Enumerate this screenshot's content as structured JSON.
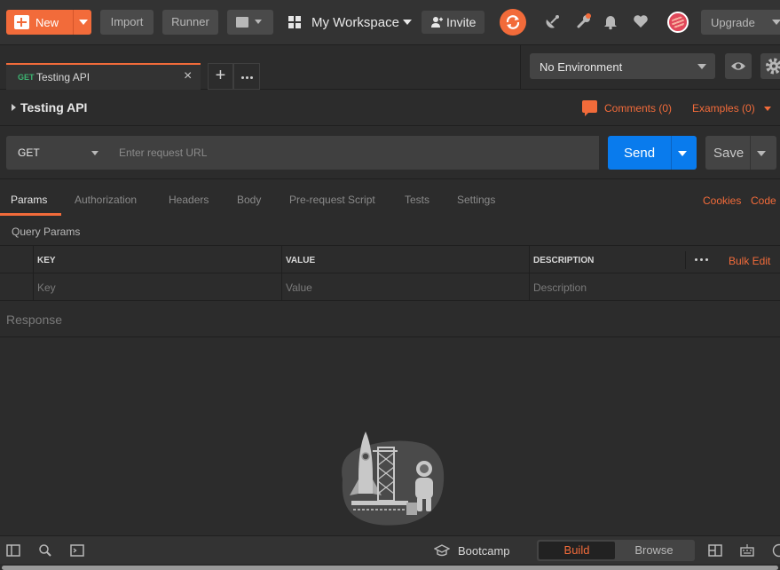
{
  "header": {
    "new_label": "New",
    "import_label": "Import",
    "runner_label": "Runner",
    "workspace_label": "My Workspace",
    "invite_label": "Invite",
    "upgrade_label": "Upgrade",
    "accent_color": "#f26b3a"
  },
  "tabs": [
    {
      "method": "GET",
      "name": "Testing API"
    }
  ],
  "environment": {
    "selected": "No Environment"
  },
  "request": {
    "title": "Testing API",
    "comments_label": "Comments (0)",
    "examples_label": "Examples (0)",
    "method": "GET",
    "url_placeholder": "Enter request URL",
    "send_label": "Send",
    "save_label": "Save",
    "send_color": "#097bed"
  },
  "request_tabs": {
    "items": [
      "Params",
      "Authorization",
      "Headers",
      "Body",
      "Pre-request Script",
      "Tests",
      "Settings"
    ],
    "active": "Params",
    "cookies_label": "Cookies",
    "code_label": "Code"
  },
  "params": {
    "section_title": "Query Params",
    "columns": [
      "KEY",
      "VALUE",
      "DESCRIPTION"
    ],
    "bulk_edit_label": "Bulk Edit",
    "placeholders": {
      "key": "Key",
      "value": "Value",
      "description": "Description"
    }
  },
  "response": {
    "label": "Response"
  },
  "footer": {
    "bootcamp_label": "Bootcamp",
    "build_label": "Build",
    "browse_label": "Browse"
  },
  "icons": [
    "plus-icon",
    "new-window-icon",
    "workspace-grid-icon",
    "add-user-icon",
    "sync-icon",
    "satellite-icon",
    "wrench-icon",
    "bell-icon",
    "heart-icon",
    "eye-icon",
    "gear-icon",
    "comment-icon",
    "sidebar-icon",
    "search-icon",
    "console-icon",
    "bootcamp-icon",
    "two-pane-icon",
    "keyboard-icon",
    "help-icon"
  ]
}
